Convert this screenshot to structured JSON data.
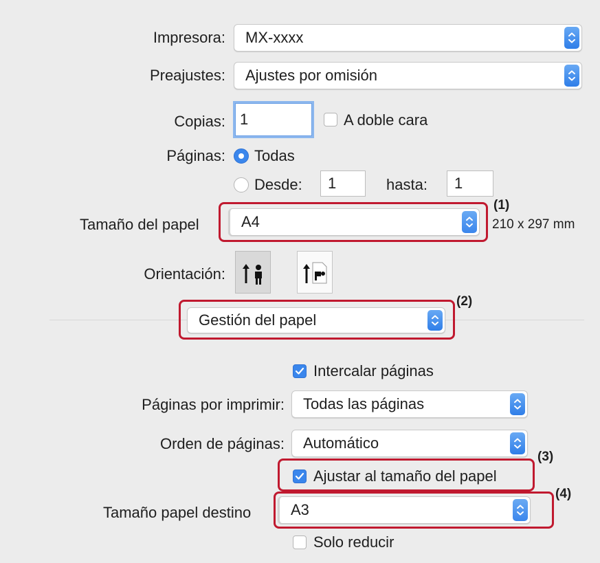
{
  "printer": {
    "label": "Impresora:",
    "value": "MX-xxxx"
  },
  "presets": {
    "label": "Preajustes:",
    "value": "Ajustes por omisión"
  },
  "copies": {
    "label": "Copias:",
    "value": "1",
    "duplex_label": "A doble cara"
  },
  "pages": {
    "label": "Páginas:",
    "all_label": "Todas",
    "from_label": "Desde:",
    "from_value": "1",
    "to_label": "hasta:",
    "to_value": "1"
  },
  "paper_size": {
    "label": "Tamaño del papel",
    "value": "A4",
    "dimensions": "210 x 297 mm"
  },
  "orientation": {
    "label": "Orientación:"
  },
  "panel_menu": {
    "value": "Gestión del papel"
  },
  "collate": {
    "label": "Intercalar páginas",
    "checked": true
  },
  "pages_to_print": {
    "label": "Páginas por imprimir:",
    "value": "Todas las páginas"
  },
  "page_order": {
    "label": "Orden de páginas:",
    "value": "Automático"
  },
  "scale_to_fit": {
    "label": "Ajustar al tamaño del papel",
    "checked": true
  },
  "destination_size": {
    "label": "Tamaño papel destino",
    "value": "A3"
  },
  "scale_down_only": {
    "label": "Solo reducir",
    "checked": false
  },
  "callouts": [
    "(1)",
    "(2)",
    "(3)",
    "(4)"
  ],
  "colors": {
    "accent": "#3a86ec",
    "callout": "#c0192f",
    "background": "#ececec"
  }
}
